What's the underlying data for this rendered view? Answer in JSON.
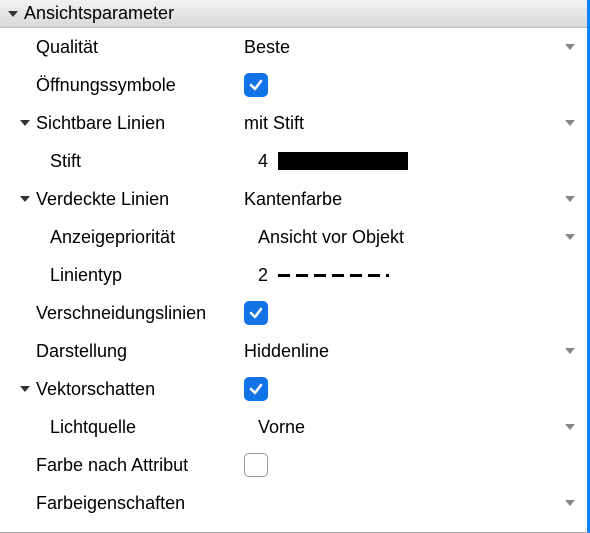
{
  "section": {
    "title": "Ansichtsparameter"
  },
  "rows": {
    "quality": {
      "label": "Qualität",
      "value": "Beste"
    },
    "openingSymbols": {
      "label": "Öffnungssymbole"
    },
    "visibleLines": {
      "label": "Sichtbare Linien",
      "value": "mit Stift"
    },
    "pen": {
      "label": "Stift",
      "value": "4"
    },
    "hiddenLines": {
      "label": "Verdeckte Linien",
      "value": "Kantenfarbe"
    },
    "displayPriority": {
      "label": "Anzeigepriorität",
      "value": "Ansicht vor Objekt"
    },
    "linetype": {
      "label": "Linientyp",
      "value": "2"
    },
    "intersection": {
      "label": "Verschneidungslinien"
    },
    "representation": {
      "label": "Darstellung",
      "value": "Hiddenline"
    },
    "vectorShadow": {
      "label": "Vektorschatten"
    },
    "lightSource": {
      "label": "Lichtquelle",
      "value": "Vorne"
    },
    "colorByAttr": {
      "label": "Farbe nach Attribut"
    },
    "colorProps": {
      "label": "Farbeigenschaften"
    }
  }
}
